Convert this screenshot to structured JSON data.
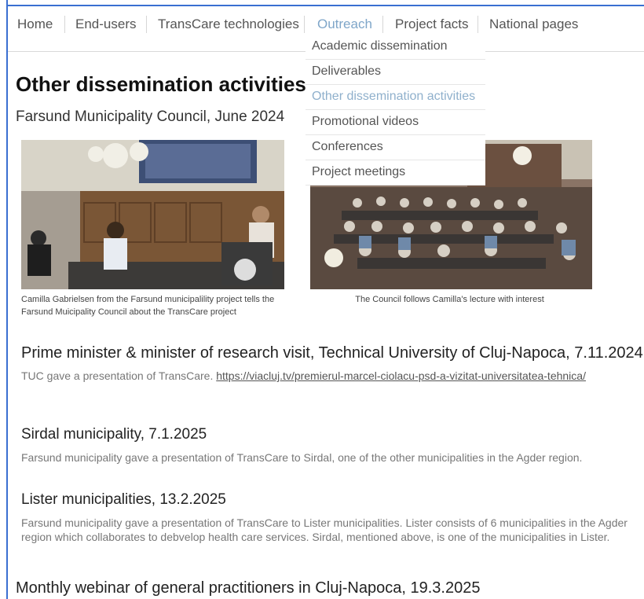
{
  "nav": {
    "items": [
      "Home",
      "End-users",
      "TransCare technologies",
      "Outreach",
      "Project facts",
      "National pages"
    ],
    "active": "Outreach"
  },
  "dropdown": {
    "items": [
      "Academic dissemination",
      "Deliverables",
      "Other dissemination activities",
      "Promotional videos",
      "Conferences",
      "Project meetings"
    ],
    "active": "Other dissemination activities"
  },
  "page": {
    "title": "Other dissemination activities",
    "subtitle": "Farsund Municipality Council, June 2024"
  },
  "captions": {
    "left": "Camilla Gabrielsen from the Farsund municipalility project tells the Farsund Muicipality Council about the TransCare project",
    "right": "The Council follows Camilla's lecture with interest"
  },
  "sections": [
    {
      "title": "Prime minister & minister of research visit, Technical University of Cluj-Napoca, 7.11.2024",
      "text": "TUC gave a presentation of TransCare.",
      "link": "https://viacluj.tv/premierul-marcel-ciolacu-psd-a-vizitat-universitatea-tehnica/"
    },
    {
      "title": "Sirdal municipality, 7.1.2025",
      "text": "Farsund municipality gave a presentation of TransCare to Sirdal, one of the other municipalities in the Agder region."
    },
    {
      "title": "Lister municipalities, 13.2.2025",
      "text": "Farsund municipality gave a presentation of TransCare to Lister municipalities. Lister consists of 6 municipalities in the Agder region which collaborates to debvelop health care services. Sirdal, mentioned above, is one of the municipalities in Lister."
    },
    {
      "title": "Monthly webinar of general practitioners in Cluj-Napoca, 19.3.2025"
    }
  ],
  "colors": {
    "frame": "#3a6fd1",
    "active_link": "#7fa6c9"
  }
}
